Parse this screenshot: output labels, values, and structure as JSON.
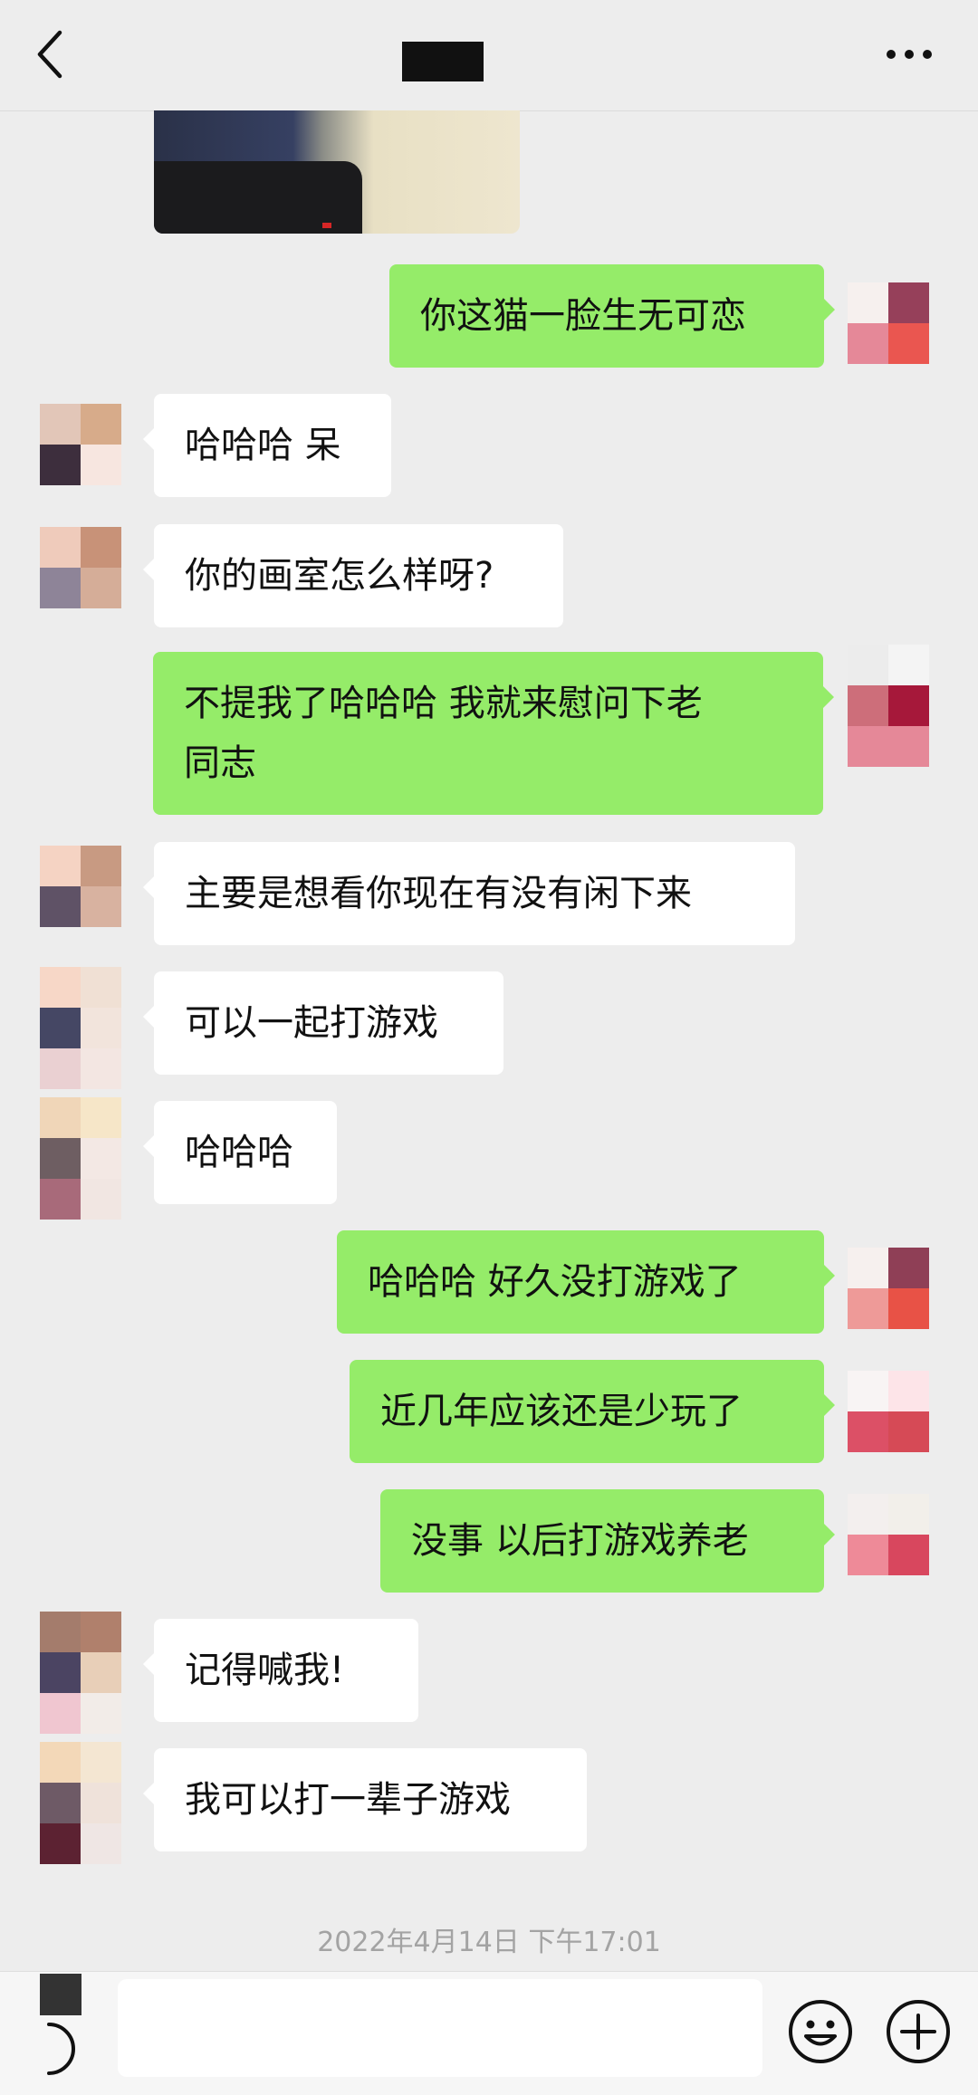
{
  "header": {
    "back_icon": "chevron-left-icon",
    "title_redacted": true,
    "more_icon": "ellipsis-icon"
  },
  "messages": [
    {
      "side": "out",
      "text": "你这猫一脸生无可恋"
    },
    {
      "side": "in",
      "text": "哈哈哈 呆"
    },
    {
      "side": "in",
      "text": "你的画室怎么样呀?"
    },
    {
      "side": "out",
      "text": "不提我了哈哈哈 我就来慰问下老\n同志"
    },
    {
      "side": "in",
      "text": "主要是想看你现在有没有闲下来"
    },
    {
      "side": "in",
      "text": "可以一起打游戏"
    },
    {
      "side": "in",
      "text": "哈哈哈"
    },
    {
      "side": "out",
      "text": "哈哈哈 好久没打游戏了"
    },
    {
      "side": "out",
      "text": "近几年应该还是少玩了"
    },
    {
      "side": "out",
      "text": "没事 以后打游戏养老"
    },
    {
      "side": "in",
      "text": "记得喊我!"
    },
    {
      "side": "in",
      "text": "我可以打一辈子游戏"
    }
  ],
  "timestamp": "2022年4月14日 下午17:01",
  "input_bar": {
    "voice_icon": "voice-icon",
    "input_value": "",
    "emoji_icon": "emoji-icon",
    "plus_icon": "plus-icon"
  },
  "colors": {
    "background": "#ededed",
    "bubble_out": "#95ec69",
    "bubble_in": "#ffffff"
  }
}
